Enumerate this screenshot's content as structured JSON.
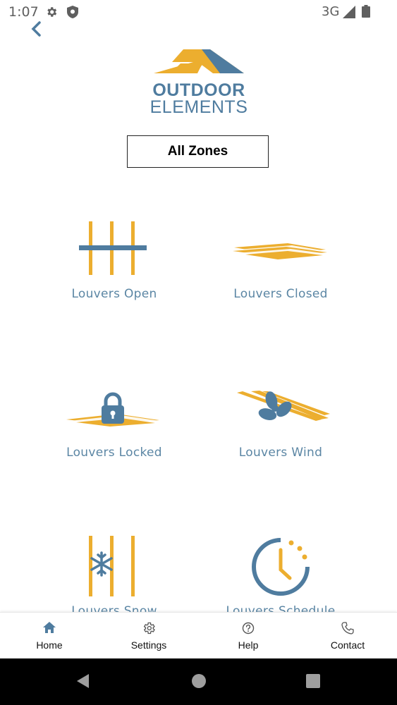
{
  "status_bar": {
    "time": "1:07",
    "network": "3G"
  },
  "header": {
    "logo_top": "OUTDOOR",
    "logo_bottom": "ELEMENTS"
  },
  "zone_selector": {
    "label": "All Zones"
  },
  "tiles": [
    {
      "label": "Louvers Open"
    },
    {
      "label": "Louvers Closed"
    },
    {
      "label": "Louvers Locked"
    },
    {
      "label": "Louvers Wind"
    },
    {
      "label": "Louvers Snow"
    },
    {
      "label": "Louvers Schedule"
    }
  ],
  "bottom_nav": [
    {
      "label": "Home"
    },
    {
      "label": "Settings"
    },
    {
      "label": "Help"
    },
    {
      "label": "Contact"
    }
  ],
  "colors": {
    "accent_yellow": "#ecae2f",
    "accent_blue": "#4f7c9f",
    "label_blue": "#5b86a4"
  }
}
